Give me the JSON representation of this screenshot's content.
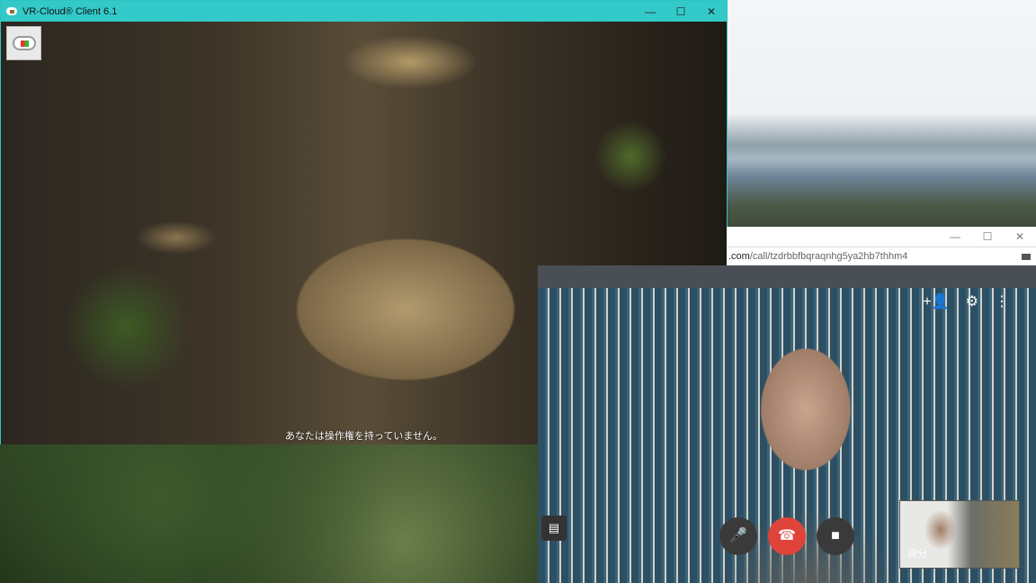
{
  "vr_window": {
    "title": "VR-Cloud® Client 6.1",
    "controls": {
      "minimize": "—",
      "maximize": "☐",
      "close": "✕"
    },
    "status_message": "あなたは操作権を持っていません。"
  },
  "browser": {
    "controls": {
      "minimize": "—",
      "maximize": "☐",
      "close": "✕"
    },
    "url_domain": ".com",
    "url_path": "/call/tzdrbbfbqraqnhg5ya2hb7thhm4",
    "self_label": "自分",
    "icons": {
      "add_person": "+👤",
      "settings": "⚙",
      "more": "⋮",
      "chat": "▤",
      "mic": "🎤",
      "hangup": "☎",
      "camera": "■"
    }
  },
  "colors": {
    "titlebar": "#33c9c9",
    "hangup": "#e0433a"
  }
}
